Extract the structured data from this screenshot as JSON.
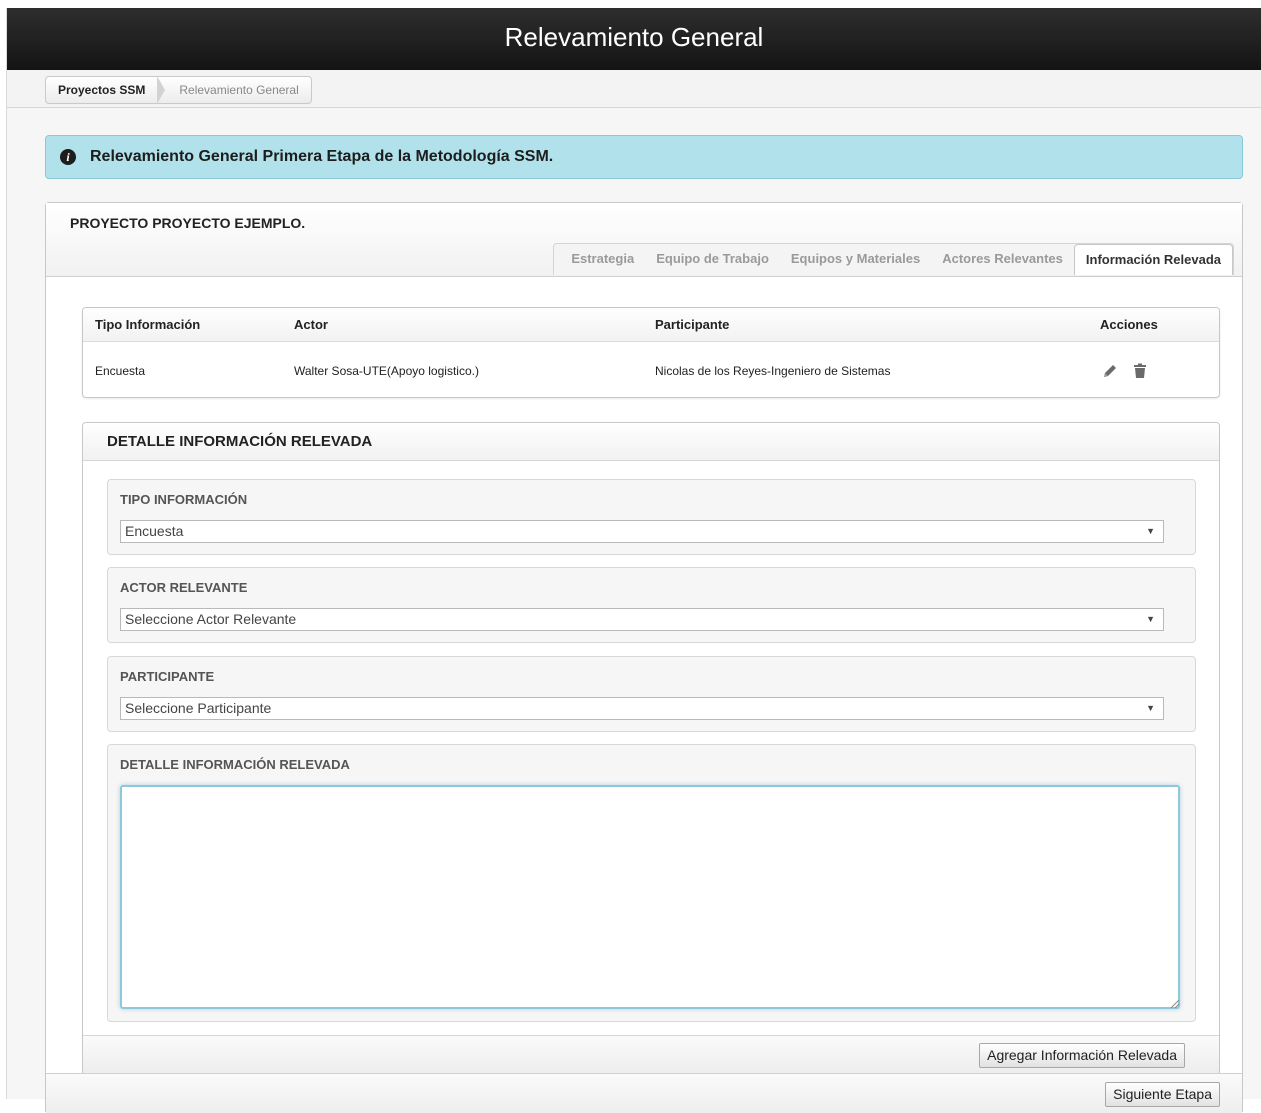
{
  "header": {
    "title": "Relevamiento General"
  },
  "breadcrumb": {
    "items": [
      "Proyectos SSM",
      "Relevamiento General"
    ]
  },
  "info": {
    "icon": "info-circle-icon",
    "message": "Relevamiento General Primera Etapa de la Metodología SSM."
  },
  "project": {
    "title": "PROYECTO PROYECTO EJEMPLO.",
    "tabs": [
      "Estrategia",
      "Equipo de Trabajo",
      "Equipos y Materiales",
      "Actores Relevantes",
      "Información Relevada"
    ],
    "active_tab": "Información Relevada"
  },
  "table": {
    "columns": [
      "Tipo Información",
      "Actor",
      "Participante",
      "Acciones"
    ],
    "rows": [
      {
        "tipo": "Encuesta",
        "actor": "Walter Sosa-UTE(Apoyo logistico.)",
        "participante": "Nicolas de los Reyes-Ingeniero de Sistemas",
        "actions": [
          "pencil-icon",
          "trash-icon"
        ]
      }
    ]
  },
  "detail": {
    "title": "DETALLE INFORMACIÓN RELEVADA",
    "tipo_label": "TIPO INFORMACIÓN",
    "tipo_value": "Encuesta",
    "actor_label": "ACTOR RELEVANTE",
    "actor_value": "Seleccione Actor Relevante",
    "participante_label": "PARTICIPANTE",
    "participante_value": "Seleccione Participante",
    "detalle_label": "DETALLE INFORMACIÓN RELEVADA",
    "detalle_value": "",
    "add_button": "Agregar Información Relevada"
  },
  "footer": {
    "next_button": "Siguiente Etapa"
  },
  "colors": {
    "header_bg": "#1c1c1c",
    "info_bg": "#b1e2ec",
    "focus_border": "#8fc7dd"
  }
}
